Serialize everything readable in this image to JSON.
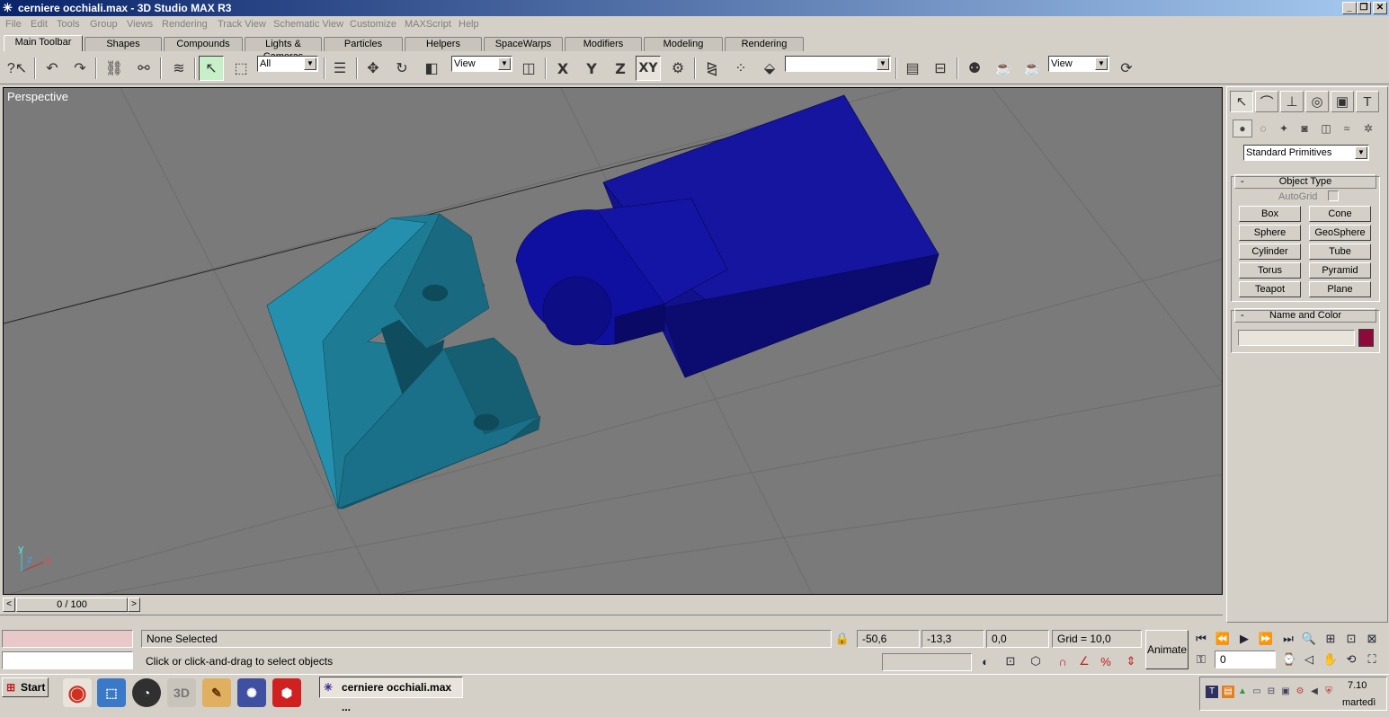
{
  "window": {
    "title": "cerniere occhiali.max - 3D Studio MAX R3",
    "controls": [
      "_",
      "❐",
      "✕"
    ]
  },
  "menu": [
    "File",
    "Edit",
    "Tools",
    "Group",
    "Views",
    "Rendering",
    "Track View",
    "Schematic View",
    "Customize",
    "MAXScript",
    "Help"
  ],
  "tabs": [
    "Main Toolbar",
    "Shapes",
    "Compounds",
    "Lights & Cameras",
    "Particles",
    "Helpers",
    "SpaceWarps",
    "Modifiers",
    "Modeling",
    "Rendering"
  ],
  "toolbar": {
    "selection_filter": "All",
    "coord_system": "View",
    "axis_x": "X",
    "axis_y": "Y",
    "axis_z": "Z",
    "axis_xy": "XY",
    "named_selection": "",
    "render_view": "View"
  },
  "viewport": {
    "label": "Perspective",
    "axis_y": "y",
    "axis_z": "z",
    "axis_x": "x",
    "colors": {
      "background": "#7a7a7a",
      "cyan_object": "#1e7b94",
      "blue_object": "#12128c"
    }
  },
  "command_panel": {
    "category": "Standard Primitives",
    "object_type_title": "Object Type",
    "autogrid_label": "AutoGrid",
    "buttons": [
      "Box",
      "Cone",
      "Sphere",
      "GeoSphere",
      "Cylinder",
      "Tube",
      "Torus",
      "Pyramid",
      "Teapot",
      "Plane"
    ],
    "name_color_title": "Name and Color",
    "name_value": "",
    "object_color": "#8b0a3a"
  },
  "timeline": {
    "frame": "0 / 100",
    "prev": "<",
    "next": ">"
  },
  "status": {
    "selection": "None Selected",
    "prompt": "Click or click-and-drag to select objects",
    "x": "-50,6",
    "y": "-13,3",
    "z": "0,0",
    "grid": "Grid = 10,0",
    "animate": "Animate",
    "current_frame": "0"
  },
  "taskbar": {
    "start": "Start",
    "active_task": "cerniere occhiali.max ...",
    "time": "7.10",
    "day": "martedì"
  }
}
